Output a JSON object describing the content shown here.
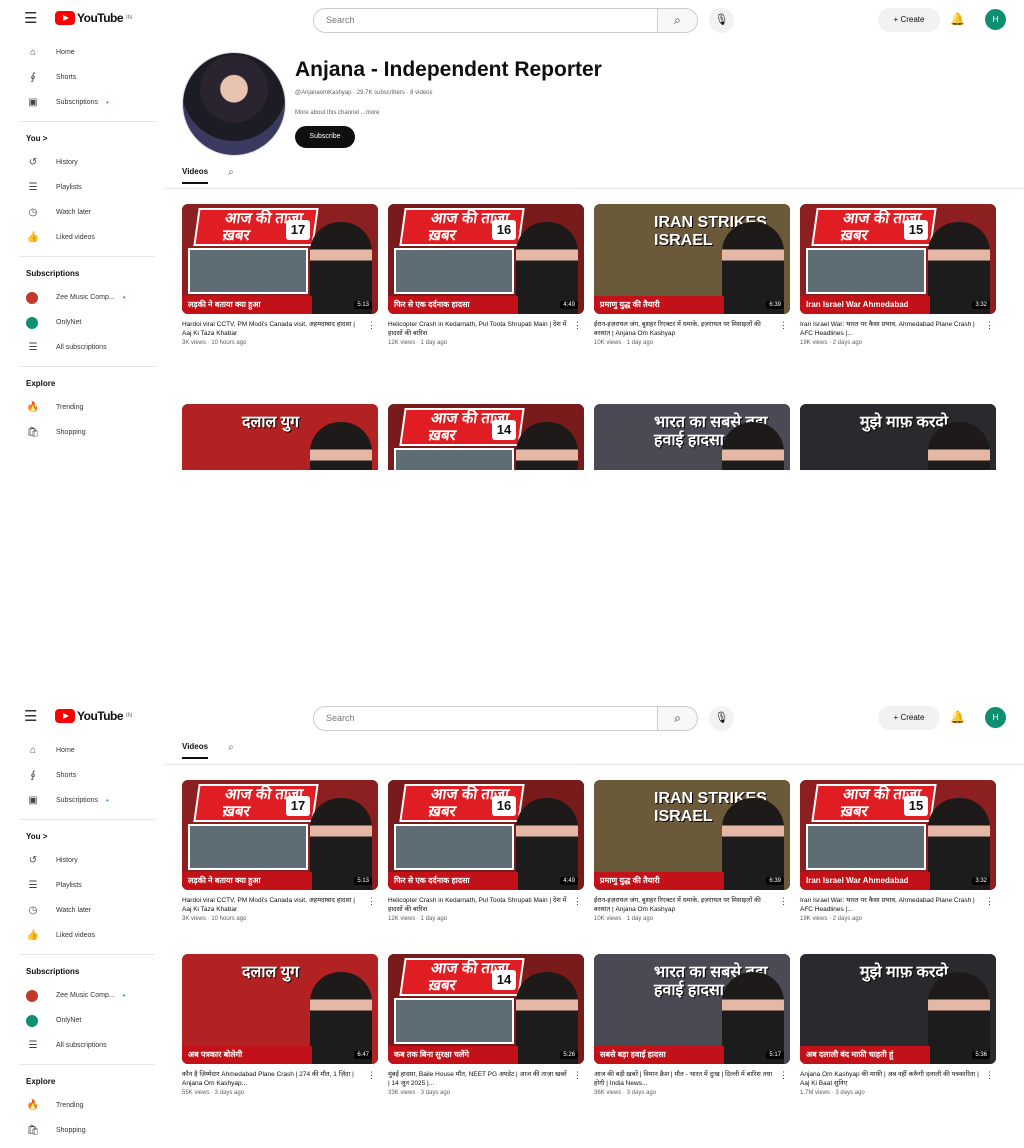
{
  "header": {
    "logo_text": "YouTube",
    "logo_sup": "IN",
    "search_placeholder": "Search",
    "create_label": "+ Create",
    "avatar_letter": "H"
  },
  "sidebar": {
    "main": [
      {
        "icon": "⌂",
        "label": "Home"
      },
      {
        "icon": "∮",
        "label": "Shorts"
      },
      {
        "icon": "▣",
        "label": "Subscriptions"
      }
    ],
    "you_heading": "You  >",
    "you": [
      {
        "icon": "↺",
        "label": "History"
      },
      {
        "icon": "☰",
        "label": "Playlists"
      },
      {
        "icon": "◷",
        "label": "Watch later"
      },
      {
        "icon": "👍",
        "label": "Liked videos"
      }
    ],
    "subs_heading": "Subscriptions",
    "subs": [
      {
        "color": "#c0392b",
        "label": "Zee Music Comp..."
      },
      {
        "color": "#0f8f72",
        "label": "OnlyNet"
      },
      {
        "icon": "☰",
        "label": "All subscriptions"
      }
    ],
    "explore_heading": "Explore",
    "explore": [
      {
        "icon": "🔥",
        "label": "Trending"
      },
      {
        "icon": "🛍",
        "label": "Shopping"
      }
    ]
  },
  "channel": {
    "name": "Anjana - Independent Reporter",
    "meta": "@AnjanaomKashyap · 29.7K subscribers · 8 videos",
    "desc": "More about this channel ...more",
    "subscribe": "Subscribe"
  },
  "tabs": {
    "videos": "Videos"
  },
  "videos": [
    {
      "top": "आज की ताज़ा ख़बर",
      "num": "17",
      "cap": "लड़की ने बताया क्या हुआ",
      "dur": "5:13",
      "bg": "#8c2020",
      "title": "Hardoi viral CCTV, PM Modi's Canada visit, अहमदाबाद हादसा | Aaj Ki Taza Khabar",
      "meta": "3K views · 10 hours ago"
    },
    {
      "top": "आज की ताज़ा ख़बर",
      "num": "16",
      "cap": "फिर से एक दर्दनाक हादसा",
      "dur": "4:49",
      "bg": "#7a1b1b",
      "title": "Helicopter Crash in Kedarnath, Pul Toota Shrupati Main | देश में हादसों की बारिश",
      "meta": "12K views · 1 day ago"
    },
    {
      "top": "IRAN STRIKES ISRAEL",
      "num": "",
      "cap": "प्रमाणु युद्ध की तैयारी",
      "dur": "6:39",
      "bg": "#6b5a3a",
      "title": "ईरान-इज़रायल जंग, बुशहर रिएक्टर में धमाके, इज़रायल पर मिसाइलों की बरसात | Anjana Om Kashyap",
      "meta": "10K views · 1 day ago"
    },
    {
      "top": "आज की ताज़ा ख़बर",
      "num": "15",
      "cap": "Iran Israel War Ahmedabad",
      "dur": "3:32",
      "bg": "#8c2020",
      "title": "Iran Israel War: भारत पर कैसा प्रभाव, Ahmedabad Plane Crash | AFC Headlines |...",
      "meta": "19K views · 2 days ago"
    },
    {
      "top": "दलाल युग",
      "num": "",
      "cap": "अब पत्रकार बोलेगी",
      "dur": "6:47",
      "bg": "#b22222",
      "title": "कौन है ज़िम्मेदार Ahmedabad Plane Crash | 274 की मौत, 1 ज़िंदा | Anjana Om Kashyap...",
      "meta": "55K views · 3 days ago"
    },
    {
      "top": "आज की ताज़ा ख़बर",
      "num": "14",
      "cap": "कब तक बिना सुरक्षा चलेंगे",
      "dur": "5:26",
      "bg": "#7a1b1b",
      "title": "मुंबई हादसा, Baile House मौत, NEET PG अपडेट | आज की ताज़ा खबरें | 14 जून 2025 |...",
      "meta": "33K views · 3 days ago"
    },
    {
      "top": "भारत का सबसे बड़ा हवाई हादसा",
      "num": "",
      "cap": "सबसे बड़ा हवाई हादसा",
      "dur": "5:17",
      "bg": "#4a4a55",
      "title": "आज की बड़ी ख़बरें | विमान क्रैश | मौत - भारत में दुःख | दिल्ली में बारिश तथा होगी | India News...",
      "meta": "36K views · 3 days ago"
    },
    {
      "top": "मुझे माफ़ करदो",
      "num": "",
      "cap": "अब दलाली बंद माफ़ी चाहती हूं",
      "dur": "5:36",
      "bg": "#2a2a2e",
      "title": "Anjana Om Kashyap की माफ़ी | अब नहीं करूँगी दलाली की पत्रकारिता | Aaj Ki Baat सुनिए",
      "meta": "1.7M views · 3 days ago"
    }
  ]
}
